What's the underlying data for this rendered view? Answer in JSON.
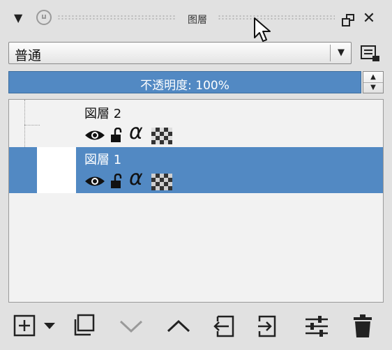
{
  "panel": {
    "title": "图層"
  },
  "blend_mode": {
    "value": "普通"
  },
  "opacity": {
    "label": "不透明度: 100%"
  },
  "layers": [
    {
      "name": "図層 2",
      "selected": false
    },
    {
      "name": "図層 1",
      "selected": true
    }
  ],
  "icons": {
    "collapse": "collapse-triangle-icon",
    "lock": "panel-lock-icon",
    "float": "float-panel-icon",
    "close": "close-icon",
    "visibility": "eye-icon",
    "layer_lock": "lock-icon",
    "alpha": "alpha-icon",
    "transparency": "checker-icon"
  },
  "colors": {
    "selection": "#5289c3",
    "background": "#e1e1e1",
    "list_background": "#f2f2f2"
  }
}
